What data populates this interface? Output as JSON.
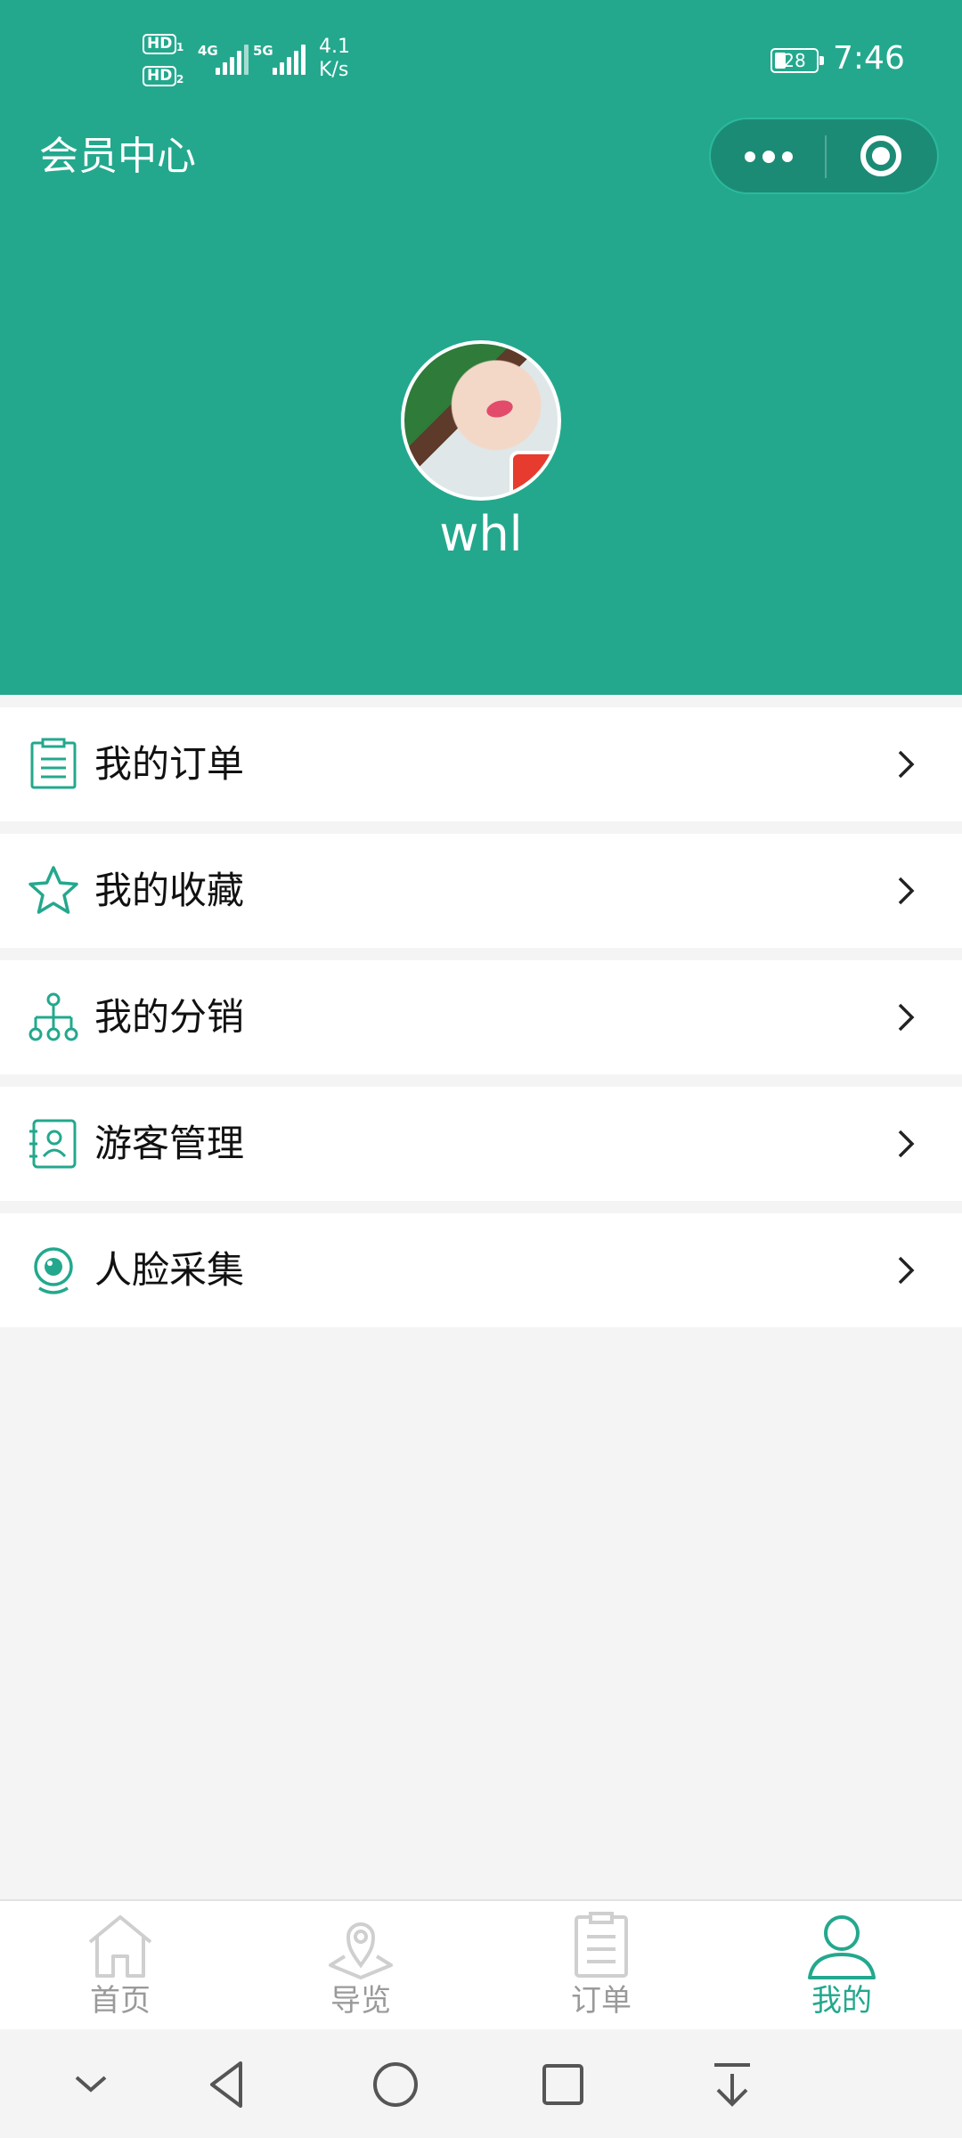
{
  "status": {
    "net1": "4G",
    "net2": "5G",
    "speed_value": "4.1",
    "speed_unit": "K/s",
    "battery": "28",
    "time": "7:46"
  },
  "header": {
    "title": "会员中心"
  },
  "profile": {
    "username": "whl"
  },
  "menu": {
    "items": [
      {
        "label": "我的订单",
        "icon": "order-icon"
      },
      {
        "label": "我的收藏",
        "icon": "star-icon"
      },
      {
        "label": "我的分销",
        "icon": "distribution-tree-icon"
      },
      {
        "label": "游客管理",
        "icon": "visitor-contacts-icon"
      },
      {
        "label": "人脸采集",
        "icon": "camera-icon"
      }
    ]
  },
  "tabbar": {
    "tabs": [
      {
        "label": "首页",
        "icon": "home-icon",
        "active": false
      },
      {
        "label": "导览",
        "icon": "map-pin-icon",
        "active": false
      },
      {
        "label": "订单",
        "icon": "clipboard-icon",
        "active": false
      },
      {
        "label": "我的",
        "icon": "user-icon",
        "active": true
      }
    ]
  },
  "colors": {
    "brand": "#23a88d",
    "inactive": "#9a9a9a",
    "background": "#f4f4f4"
  }
}
